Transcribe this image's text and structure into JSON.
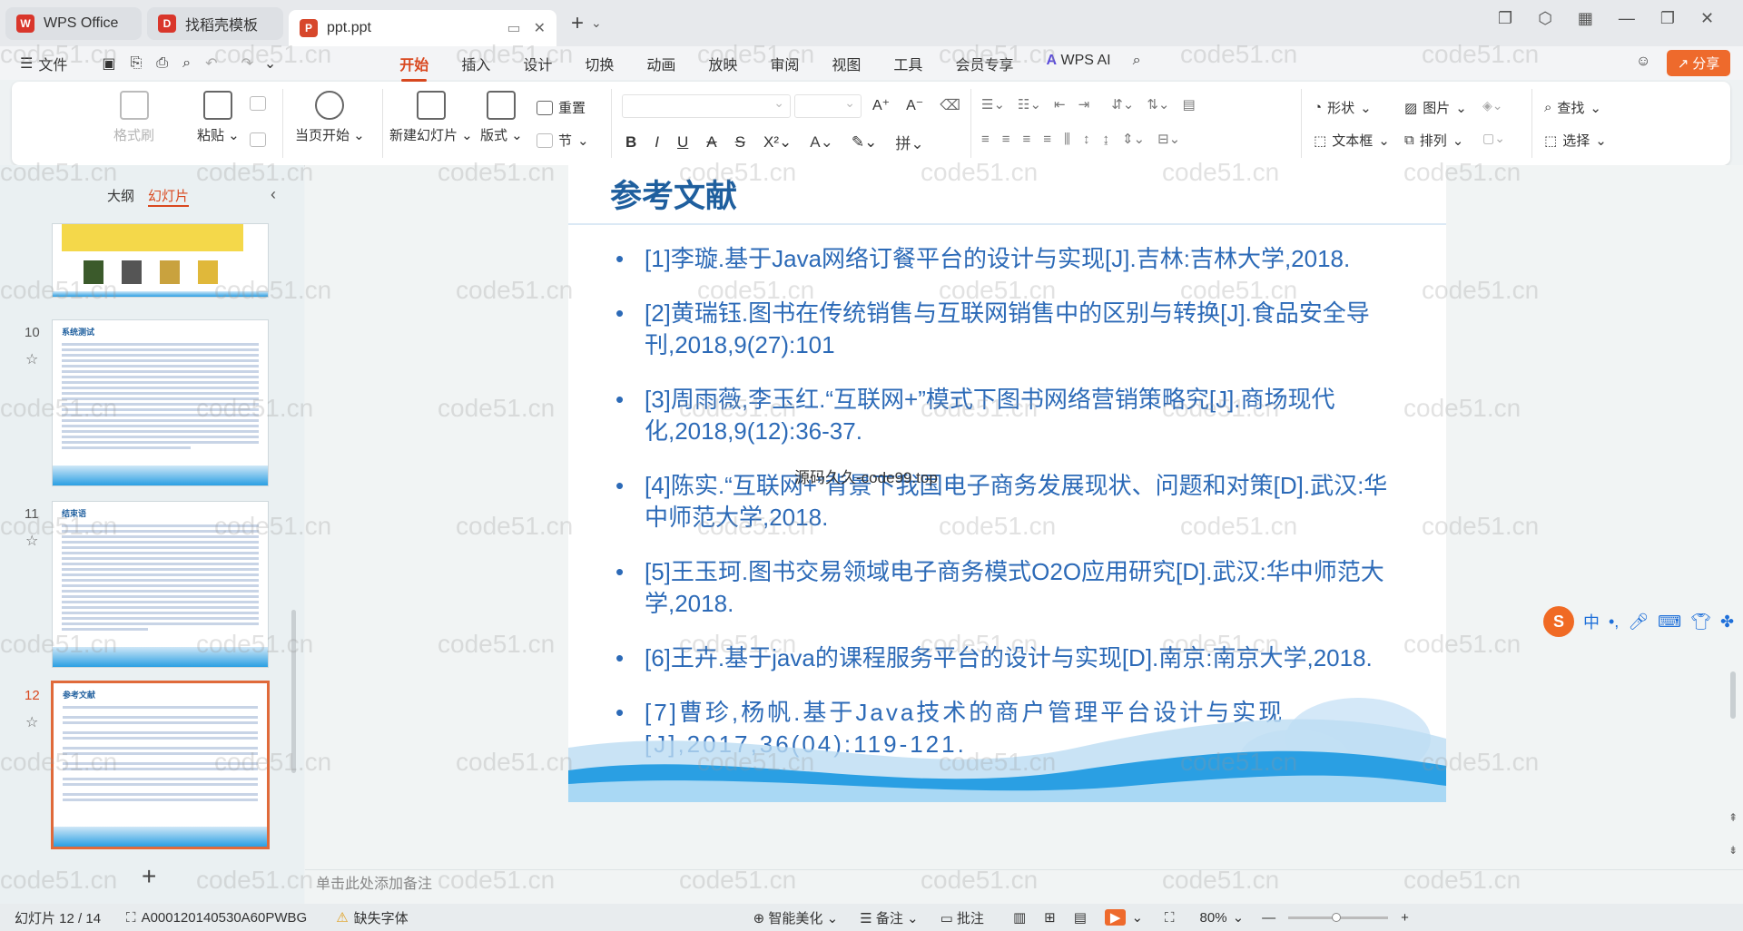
{
  "tabs": [
    {
      "label": "WPS Office",
      "logo": "W",
      "color": "#d9362b"
    },
    {
      "label": "找稻壳模板",
      "logo": "D",
      "color": "#d9362b"
    },
    {
      "label": "ppt.ppt",
      "logo": "P",
      "color": "#d7472b"
    }
  ],
  "menu": {
    "file": "文件",
    "items": [
      "开始",
      "插入",
      "设计",
      "切换",
      "动画",
      "放映",
      "审阅",
      "视图",
      "工具",
      "会员专享"
    ],
    "ai": "WPS AI",
    "share": "分享"
  },
  "ribbon": {
    "format_brush": "格式刷",
    "paste": "粘贴",
    "play_current": "当页开始",
    "new_slide": "新建幻灯片",
    "layout": "版式",
    "reset": "重置",
    "section": "节",
    "shape": "形状",
    "picture": "图片",
    "textbox": "文本框",
    "arrange": "排列",
    "find": "查找",
    "select": "选择"
  },
  "panel": {
    "outline_tab": "大纲",
    "slides_tab": "幻灯片",
    "slide_numbers": [
      "10",
      "11",
      "12"
    ],
    "thumb_titles": [
      "系统测试",
      "结束语",
      "参考文献"
    ]
  },
  "slide": {
    "title": "参考文献",
    "references": [
      "[1]李璇.基于Java网络订餐平台的设计与实现[J].吉林:吉林大学,2018.",
      "[2]黄瑞钰.图书在传统销售与互联网销售中的区别与转换[J].食品安全导刊,2018,9(27):101",
      "[3]周雨薇,李玉红.“互联网+”模式下图书网络营销策略究[J].商场现代化,2018,9(12):36-37.",
      "[4]陈实.“互联网+”背景下我国电子商务发展现状、问题和对策[D].武汉:华中师范大学,2018.",
      "[5]王玉珂.图书交易领域电子商务模式O2O应用研究[D].武汉:华中师范大学,2018.",
      "[6]王卉.基于java的课程服务平台的设计与实现[D].南京:南京大学,2018.",
      "[7]曹珍,杨帆.基于Java技术的商户管理平台设计与实现[J],2017,36(04):119-121."
    ],
    "overlay_text": "源码久久-code99.top"
  },
  "notes_placeholder": "单击此处添加备注",
  "status": {
    "slide_info": "幻灯片 12 / 14",
    "doc_id": "A000120140530A60PWBG",
    "missing_font": "缺失字体",
    "smart": "智能美化",
    "notes": "备注",
    "comment": "批注",
    "zoom": "80%"
  },
  "watermark": "code51.cn",
  "ime": {
    "label": "中"
  }
}
